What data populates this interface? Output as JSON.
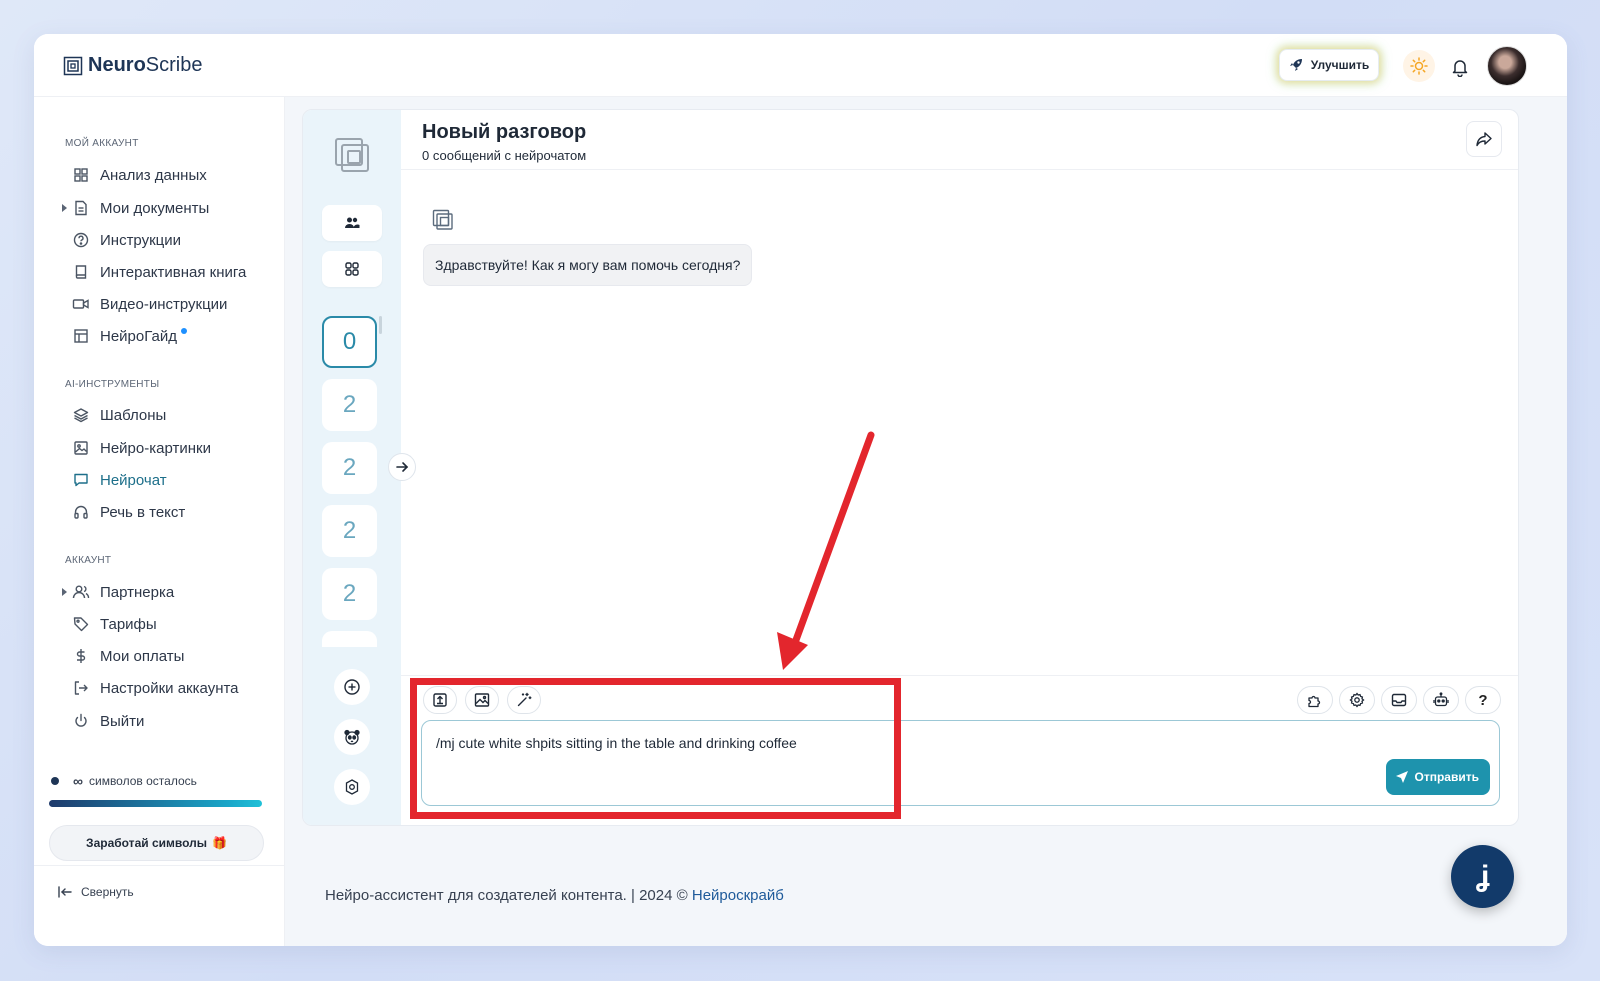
{
  "app": {
    "logo_part1": "Neuro",
    "logo_part2": "Scribe"
  },
  "header": {
    "upgrade_label": "Улучшить"
  },
  "sidebar": {
    "section_account": "МОЙ АККАУНТ",
    "section_tools": "AI-ИНСТРУМЕНТЫ",
    "section_acc": "АККАУНТ",
    "items": [
      {
        "label": "Анализ данных",
        "icon": "grid-icon"
      },
      {
        "label": "Мои документы",
        "icon": "document-icon"
      },
      {
        "label": "Инструкции",
        "icon": "help-circle-icon"
      },
      {
        "label": "Интерактивная книга",
        "icon": "book-icon"
      },
      {
        "label": "Видео-инструкции",
        "icon": "video-icon"
      },
      {
        "label": "НейроГайд",
        "icon": "table-icon"
      },
      {
        "label": "Шаблоны",
        "icon": "layers-icon"
      },
      {
        "label": "Нейро-картинки",
        "icon": "image-icon"
      },
      {
        "label": "Нейрочат",
        "icon": "chat-icon"
      },
      {
        "label": "Речь в текст",
        "icon": "headphones-icon"
      },
      {
        "label": "Партнерка",
        "icon": "users-icon"
      },
      {
        "label": "Тарифы",
        "icon": "tag-icon"
      },
      {
        "label": "Мои оплаты",
        "icon": "dollar-icon"
      },
      {
        "label": "Настройки аккаунта",
        "icon": "logout-box-icon"
      },
      {
        "label": "Выйти",
        "icon": "power-icon"
      }
    ],
    "usage_infinity": "∞",
    "usage_text": "символов осталось",
    "earn_label": "Заработай символы",
    "earn_emoji": "🎁",
    "collapse_label": "Свернуть"
  },
  "rail": {
    "counts": [
      "0",
      "2",
      "2",
      "2",
      "2"
    ]
  },
  "chat": {
    "title": "Новый разговор",
    "subtitle": "0 сообщений с нейрочатом",
    "greeting": "Здравствуйте! Как я могу вам помочь сегодня?",
    "input_value": "/mj cute white shpits sitting in the table and drinking coffee",
    "send_label": "Отправить"
  },
  "footer": {
    "text": "Нейро-ассистент для создателей контента.  | 2024 ©",
    "link": "Нейроскрайб"
  },
  "colors": {
    "accent": "#1e93ad",
    "brand_dark": "#1e3556",
    "annotation_red": "#e3262d"
  }
}
